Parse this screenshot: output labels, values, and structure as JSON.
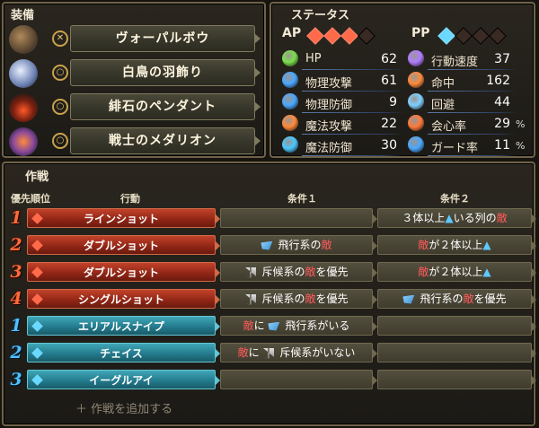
{
  "equipment": {
    "title": "装備",
    "items": [
      {
        "name": "ヴォーパルボウ",
        "slot_icon": "bow-icon"
      },
      {
        "name": "白鳥の羽飾り",
        "slot_icon": "accessory-icon"
      },
      {
        "name": "緋石のペンダント",
        "slot_icon": "accessory-icon"
      },
      {
        "name": "戦士のメダリオン",
        "slot_icon": "accessory-icon"
      }
    ]
  },
  "status": {
    "title": "ステータス",
    "ap_label": "AP",
    "ap_filled": 3,
    "ap_total": 4,
    "pp_label": "PP",
    "pp_filled": 1,
    "pp_total": 4,
    "left": [
      {
        "label": "HP",
        "value": "62",
        "icon": "hp-icon",
        "color": "#7be04a"
      },
      {
        "label": "物理攻撃",
        "value": "61",
        "icon": "sword-icon",
        "color": "#4aa8ff"
      },
      {
        "label": "物理防御",
        "value": "9",
        "icon": "armor-icon",
        "color": "#4aa8ff"
      },
      {
        "label": "魔法攻撃",
        "value": "22",
        "icon": "wand-icon",
        "color": "#ff8a3a"
      },
      {
        "label": "魔法防御",
        "value": "30",
        "icon": "magic-defense-icon",
        "color": "#4ac8ff"
      }
    ],
    "right": [
      {
        "label": "行動速度",
        "value": "37",
        "icon": "speed-icon",
        "color": "#b07cff"
      },
      {
        "label": "命中",
        "value": "162",
        "icon": "target-icon",
        "color": "#ff8a3a"
      },
      {
        "label": "回避",
        "value": "44",
        "icon": "evade-icon",
        "color": "#7fd0ff"
      },
      {
        "label": "会心率",
        "value": "29",
        "unit": "%",
        "icon": "critical-icon",
        "color": "#ff7a3a"
      },
      {
        "label": "ガード率",
        "value": "11",
        "unit": "%",
        "icon": "shield-icon",
        "color": "#4aa8ff"
      }
    ]
  },
  "tactics": {
    "title": "作戦",
    "headers": {
      "priority": "優先順位",
      "action": "行動",
      "cond1": "条件１",
      "cond2": "条件２"
    },
    "rows": [
      {
        "rank": "1",
        "type": "red",
        "action": "ラインショット",
        "cond1": [],
        "cond2": [
          [
            "t",
            "３体以上"
          ],
          [
            "tri",
            "▲"
          ],
          [
            "t",
            "いる列の"
          ],
          [
            "e",
            "敵"
          ]
        ]
      },
      {
        "rank": "2",
        "type": "red",
        "action": "ダブルショット",
        "cond1": [
          [
            "wing",
            ""
          ],
          [
            "t",
            "飛行系の"
          ],
          [
            "e",
            "敵"
          ]
        ],
        "cond2": [
          [
            "e",
            "敵"
          ],
          [
            "t",
            "が２体以上"
          ],
          [
            "tri",
            "▲"
          ]
        ]
      },
      {
        "rank": "3",
        "type": "red",
        "action": "ダブルショット",
        "cond1": [
          [
            "guard",
            ""
          ],
          [
            "t",
            "斥候系の"
          ],
          [
            "e",
            "敵"
          ],
          [
            "t",
            "を優先"
          ]
        ],
        "cond2": [
          [
            "e",
            "敵"
          ],
          [
            "t",
            "が２体以上"
          ],
          [
            "tri",
            "▲"
          ]
        ]
      },
      {
        "rank": "4",
        "type": "red",
        "action": "シングルショット",
        "cond1": [
          [
            "guard",
            ""
          ],
          [
            "t",
            "斥候系の"
          ],
          [
            "e",
            "敵"
          ],
          [
            "t",
            "を優先"
          ]
        ],
        "cond2": [
          [
            "wing",
            ""
          ],
          [
            "t",
            "飛行系の"
          ],
          [
            "e",
            "敵"
          ],
          [
            "t",
            "を優先"
          ]
        ]
      },
      {
        "rank": "1",
        "type": "blue",
        "action": "エリアルスナイプ",
        "cond1": [
          [
            "e",
            "敵"
          ],
          [
            "t",
            "に "
          ],
          [
            "wing",
            ""
          ],
          [
            "t",
            "飛行系がいる"
          ]
        ],
        "cond2": []
      },
      {
        "rank": "2",
        "type": "blue",
        "action": "チェイス",
        "cond1": [
          [
            "e",
            "敵"
          ],
          [
            "t",
            "に "
          ],
          [
            "guard",
            ""
          ],
          [
            "t",
            "斥候系がいない"
          ]
        ],
        "cond2": []
      },
      {
        "rank": "3",
        "type": "blue",
        "action": "イーグルアイ",
        "cond1": [],
        "cond2": []
      }
    ],
    "add_label": "＋ 作戦を追加する"
  },
  "colors": {
    "ap_gem": "#ff6a4a",
    "pp_gem": "#6ad8ff",
    "gem_empty": "#3a2a24",
    "enemy": "#ff5a5a"
  }
}
